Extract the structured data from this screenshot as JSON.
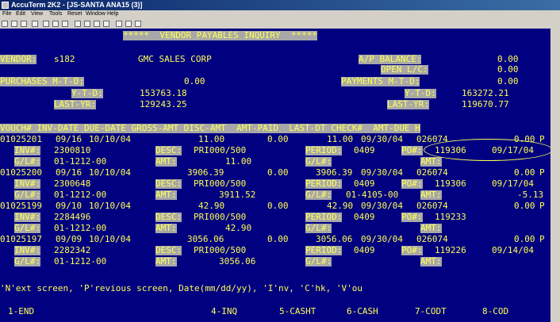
{
  "window": {
    "title": "AccuTerm 2K2 - [JS-SANTA ANA15 (3)]"
  },
  "menu": [
    "File",
    "Edit",
    "View",
    "Tools",
    "Reset",
    "Window",
    "Help"
  ],
  "toolbar_icons": [
    "new-icon",
    "open-icon",
    "save-icon",
    "print-icon",
    "cut-icon",
    "copy-icon",
    "paste-icon",
    "check-icon",
    "settings-icon",
    "font-icon",
    "color-icon",
    "keyboard-icon",
    "file-transfer-icon",
    "help-icon"
  ],
  "screen": {
    "title": "*****  VENDOR PAYABLES INQUIRY  *****",
    "vendor_label": "VENDOR:",
    "vendor_code": "s182",
    "vendor_name": "GMC SALES CORP",
    "ap_balance_label": "A/P BALANCE:",
    "ap_balance": "0.00",
    "open_lc_label": "OPEN L/C:",
    "open_lc": "0.00",
    "purchases_mtd_label": "PURCHASES M-T-D:",
    "purchases_mtd": "0.00",
    "payments_mtd_label": "PAYMENTS M-T-D:",
    "payments_mtd": "0.00",
    "ytd_label": "Y-T-D:",
    "purchases_ytd": "153763.18",
    "payments_ytd": "163272.21",
    "lastyr_label": "LAST-YR:",
    "purchases_lastyr": "129243.25",
    "payments_lastyr": "119670.77",
    "columns_header": "VOUCH# INV-DATE DUE-DATE GROSS-AMT DISC-AMT  AMT-PAID  LAST-DT CHECK#  AMT-DUE H",
    "inv_label": "INV#:",
    "desc_label": "DESC:",
    "period_label": "PERIOD:",
    "po_label": "PO#:",
    "gl_label": "G/L#:",
    "amt_label": "AMT:",
    "vouchers": [
      {
        "voucher": "01025201",
        "inv_date": "09/16",
        "due_date": "10/10/04",
        "gross": "11.00",
        "disc": "0.00",
        "paid": "11.00",
        "last_dt": "09/30/04",
        "check": "026074",
        "due": "0.00",
        "h": "P",
        "inv": "2300810",
        "desc": "PRI000/500",
        "period": "0409",
        "po": "119306",
        "po_date": "09/17/04",
        "gl": "01-1212-00",
        "amt": "11.00",
        "gl2": "",
        "amt2": ""
      },
      {
        "voucher": "01025200",
        "inv_date": "09/16",
        "due_date": "10/10/04",
        "gross": "3906.39",
        "disc": "0.00",
        "paid": "3906.39",
        "last_dt": "09/30/04",
        "check": "026074",
        "due": "0.00",
        "h": "P",
        "inv": "2300648",
        "desc": "PRI000/500",
        "period": "0409",
        "po": "119306",
        "po_date": "09/17/04",
        "gl": "01-1212-00",
        "amt": "3911.52",
        "gl2": "01-4105-00",
        "amt2": "-5.13"
      },
      {
        "voucher": "01025199",
        "inv_date": "09/10",
        "due_date": "10/10/04",
        "gross": "42.90",
        "disc": "0.00",
        "paid": "42.90",
        "last_dt": "09/30/04",
        "check": "026074",
        "due": "0.00",
        "h": "P",
        "inv": "2284496",
        "desc": "PRI000/500",
        "period": "0409",
        "po": "119233",
        "po_date": "",
        "gl": "01-1212-00",
        "amt": "42.90",
        "gl2": "",
        "amt2": ""
      },
      {
        "voucher": "01025197",
        "inv_date": "09/09",
        "due_date": "10/10/04",
        "gross": "3056.06",
        "disc": "0.00",
        "paid": "3056.06",
        "last_dt": "09/30/04",
        "check": "026074",
        "due": "0.00",
        "h": "P",
        "inv": "2282342",
        "desc": "PRI000/500",
        "period": "0409",
        "po": "119226",
        "po_date": "09/14/04",
        "gl": "01-1212-00",
        "amt": "3056.06",
        "gl2": "",
        "amt2": ""
      }
    ],
    "prompt": "'N'ext screen, 'P'revious screen, Date(mm/dd/yy), 'I'nv, 'C'hk, 'V'ou",
    "fkeys": [
      "1-END",
      "4-INQ",
      "5-CASHT",
      "6-CASH",
      "7-CODT",
      "8-COD"
    ]
  },
  "colors": {
    "background": "#000080",
    "text": "#ffff55",
    "highlight": "#a8a8a8"
  }
}
